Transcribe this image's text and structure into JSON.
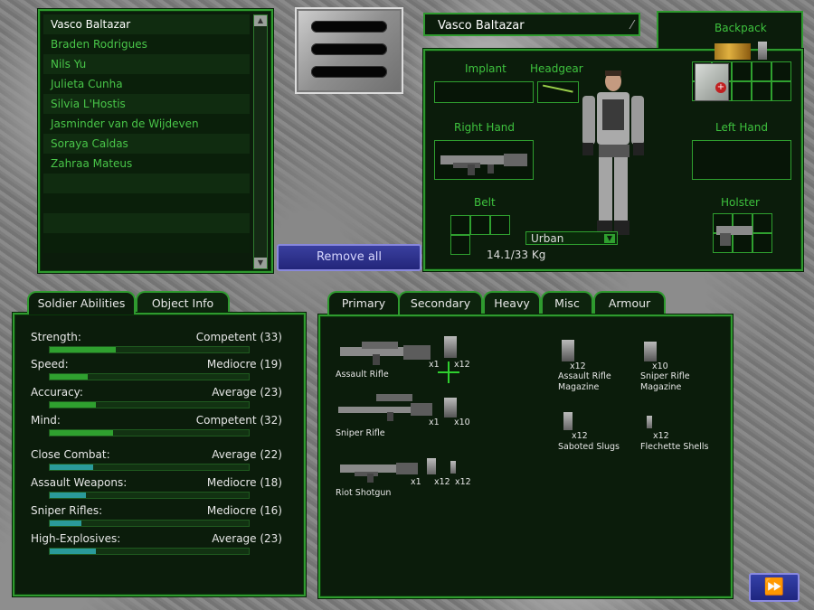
{
  "roster": {
    "soldiers": [
      {
        "name": "Vasco Baltazar",
        "selected": true
      },
      {
        "name": "Braden Rodrigues",
        "selected": false
      },
      {
        "name": "Nils Yu",
        "selected": false
      },
      {
        "name": "Julieta Cunha",
        "selected": false
      },
      {
        "name": "Silvia L'Hostis",
        "selected": false
      },
      {
        "name": "Jasminder van de Wijdeven",
        "selected": false
      },
      {
        "name": "Soraya Caldas",
        "selected": false
      },
      {
        "name": "Zahraa Mateus",
        "selected": false
      },
      {
        "name": "",
        "selected": false
      },
      {
        "name": "",
        "selected": false
      },
      {
        "name": "",
        "selected": false
      },
      {
        "name": "",
        "selected": false
      }
    ]
  },
  "remove_all_label": "Remove all",
  "equipment": {
    "soldier_name": "Vasco Baltazar",
    "backpack_label": "Backpack",
    "implant_label": "Implant",
    "headgear_label": "Headgear",
    "right_hand_label": "Right Hand",
    "left_hand_label": "Left Hand",
    "belt_label": "Belt",
    "holster_label": "Holster",
    "camouflage": "Urban",
    "weight": "14.1/33 Kg"
  },
  "abilities": {
    "tabs": [
      "Soldier Abilities",
      "Object Info"
    ],
    "items": [
      {
        "name": "Strength:",
        "rating": "Competent (33)",
        "value": 33
      },
      {
        "name": "Speed:",
        "rating": "Mediocre (19)",
        "value": 19
      },
      {
        "name": "Accuracy:",
        "rating": "Average (23)",
        "value": 23
      },
      {
        "name": "Mind:",
        "rating": "Competent (32)",
        "value": 32
      },
      {
        "name": "Close Combat:",
        "rating": "Average (22)",
        "value": 22
      },
      {
        "name": "Assault Weapons:",
        "rating": "Mediocre (18)",
        "value": 18
      },
      {
        "name": "Sniper Rifles:",
        "rating": "Mediocre (16)",
        "value": 16
      },
      {
        "name": "High-Explosives:",
        "rating": "Average (23)",
        "value": 23
      }
    ],
    "colors": {
      "basic": "#2fa02f",
      "skill": "#2a9a9a"
    }
  },
  "inventory": {
    "tabs": [
      "Primary",
      "Secondary",
      "Heavy",
      "Misc",
      "Armour"
    ],
    "weapons": [
      {
        "name": "Assault Rifle",
        "qty": "x1",
        "ammo_qty": "x12"
      },
      {
        "name": "Sniper Rifle",
        "qty": "x1",
        "ammo_qty": "x10"
      },
      {
        "name": "Riot Shotgun",
        "qty": "x1",
        "ammo_qty": "x12",
        "ammo2_qty": "x12"
      }
    ],
    "ammo": [
      {
        "name": "Assault Rifle Magazine",
        "qty": "x12"
      },
      {
        "name": "Sniper Rifle Magazine",
        "qty": "x10"
      },
      {
        "name": "Saboted Slugs",
        "qty": "x12"
      },
      {
        "name": "Flechette Shells",
        "qty": "x12"
      }
    ]
  },
  "icons": {
    "next": "fast-forward-icon",
    "pen": "pencil-icon"
  }
}
